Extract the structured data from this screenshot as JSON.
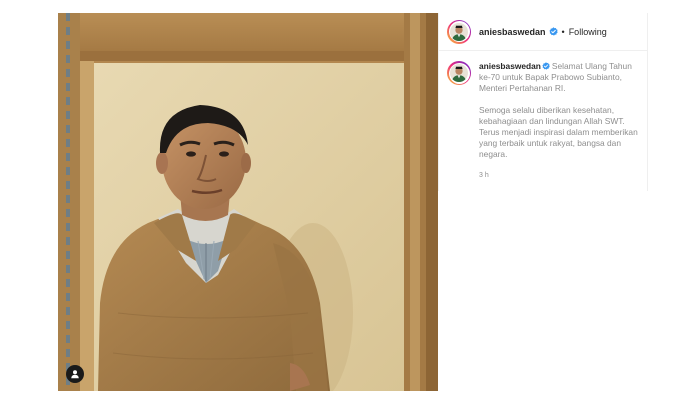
{
  "post": {
    "username": "aniesbaswedan",
    "verified_icon": "verified-badge-icon",
    "follow_separator": "•",
    "follow_status": "Following",
    "caption": {
      "author": "aniesbaswedan",
      "paragraph_1": "Selamat Ulang Tahun ke-70 untuk Bapak Prabowo Subianto, Menteri Pertahanan RI.",
      "paragraph_2": "Semoga selalu diberikan kesehatan, kebahagiaan dan lindungan Allah SWT. Terus menjadi inspirasi dalam memberikan yang terbaik untuk rakyat, bangsa dan negara."
    },
    "timestamp": "3 h",
    "tag_icon": "user-tag-icon"
  },
  "colors": {
    "verified_blue": "#3897f0",
    "text_primary": "#262626",
    "text_secondary": "#8e8e8e",
    "divider": "#efefef"
  }
}
